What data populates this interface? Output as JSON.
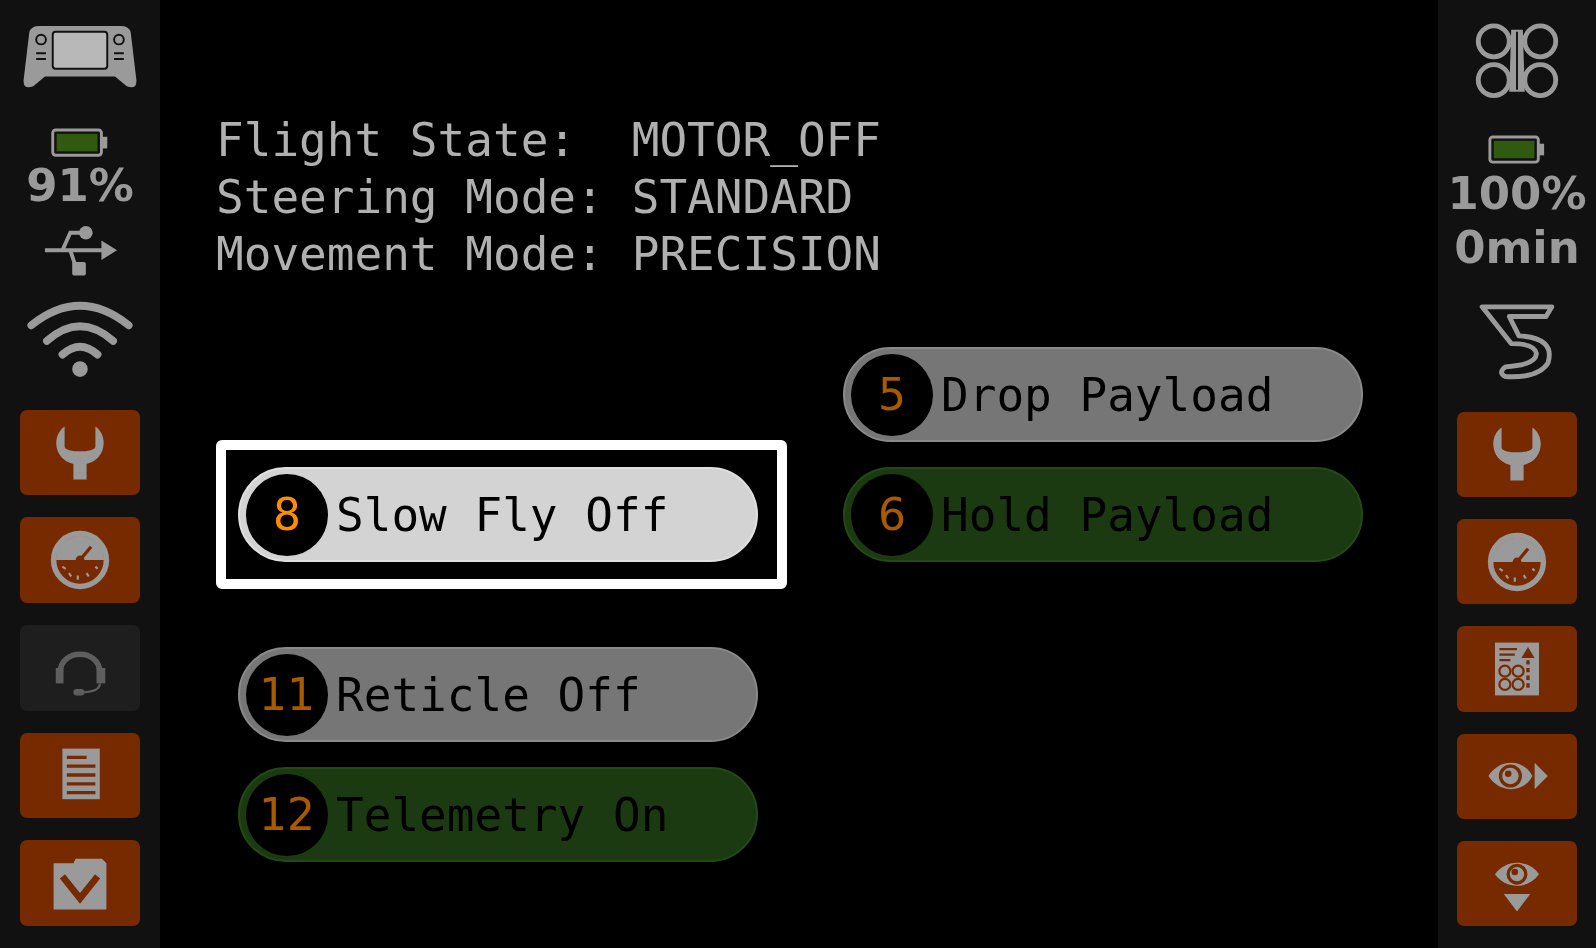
{
  "left_sidebar": {
    "battery_reading": "91%",
    "tiles": [
      {
        "disabled": false
      },
      {
        "disabled": false
      },
      {
        "disabled": true
      },
      {
        "disabled": false
      },
      {
        "disabled": false
      }
    ]
  },
  "status": [
    {
      "label": "Flight State:",
      "value": "MOTOR_OFF"
    },
    {
      "label": "Steering Mode:",
      "value": "STANDARD"
    },
    {
      "label": "Movement Mode:",
      "value": "PRECISION"
    }
  ],
  "left_buttons": [
    {
      "number": "8",
      "label": "Slow Fly Off",
      "kind": "off",
      "selected": true
    },
    {
      "number": "11",
      "label": "Reticle Off",
      "kind": "off",
      "selected": false
    },
    {
      "number": "12",
      "label": "Telemetry On",
      "kind": "on",
      "selected": false
    }
  ],
  "right_buttons": [
    {
      "number": "5",
      "label": "Drop Payload",
      "kind": "off",
      "selected": false
    },
    {
      "number": "6",
      "label": "Hold Payload",
      "kind": "on",
      "selected": false
    }
  ],
  "right_sidebar": {
    "battery_reading": "100%",
    "flight_time": "0min",
    "tiles": [
      {
        "disabled": false
      },
      {
        "disabled": false
      },
      {
        "disabled": false
      },
      {
        "disabled": false
      },
      {
        "disabled": false
      }
    ]
  }
}
